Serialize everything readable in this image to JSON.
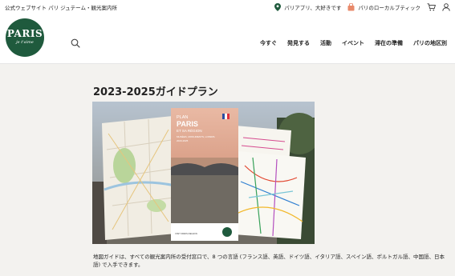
{
  "topbar": {
    "site_name": "公式ウェブサイト パリ ジュテーム・観光案内所",
    "app_link": "パリアプリ、大好きです",
    "boutique_link": "パリのローカルブティック"
  },
  "header": {
    "logo_main": "PARIS",
    "logo_sub": "je t'aime",
    "nav": [
      "今すぐ",
      "発見する",
      "活動",
      "イベント",
      "滞在の準備",
      "パリの地区別"
    ]
  },
  "main": {
    "title": "2023-2025ガイドプラン",
    "description": "地図ガイドは、すべての観光案内所の受付窓口で、8 つの言語 (フランス語、英語、ドイツ語、イタリア語、スペイン語、ポルトガル語、中国語、日本語) で入手できます。",
    "brochure": {
      "plan_label": "PLAN",
      "title_line1": "PARIS",
      "title_line2": "ET SA RÉGION",
      "subtitle": "MUSÉES, MONUMENTS, LOISIRS",
      "years": "2023-2025",
      "footer_logo": "VISIT PARIS REGION"
    }
  },
  "colors": {
    "brand_green": "#1f5a3d",
    "page_bg": "#f3f2ef"
  }
}
